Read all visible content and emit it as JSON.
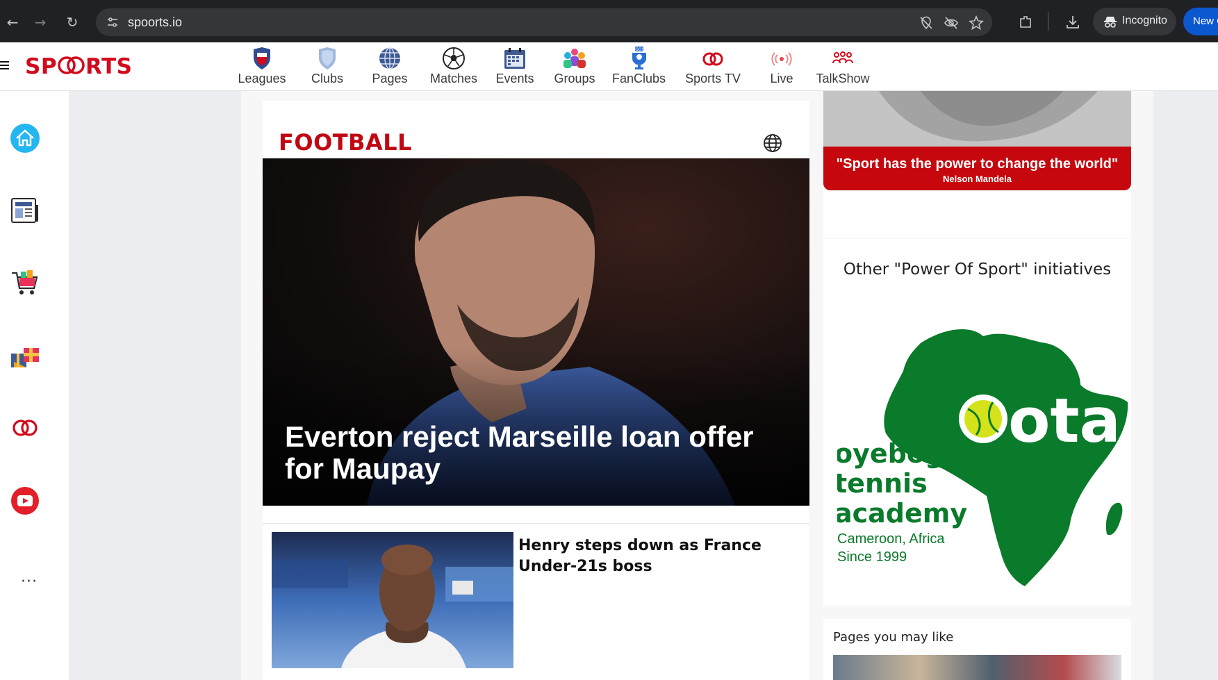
{
  "browser": {
    "url": "spoorts.io",
    "incognito_label": "Incognito",
    "new_button_label": "New C"
  },
  "site": {
    "logo": "SPOORTS",
    "nav": [
      {
        "label": "Leagues",
        "icon": "leagues-shield-icon"
      },
      {
        "label": "Clubs",
        "icon": "clubs-shield-icon"
      },
      {
        "label": "Pages",
        "icon": "globe-icon"
      },
      {
        "label": "Matches",
        "icon": "soccer-ball-icon"
      },
      {
        "label": "Events",
        "icon": "calendar-icon"
      },
      {
        "label": "Groups",
        "icon": "groups-icon"
      },
      {
        "label": "FanClubs",
        "icon": "fanclubs-icon"
      },
      {
        "label": "Sports TV",
        "icon": "sports-tv-icon"
      },
      {
        "label": "Live",
        "icon": "live-broadcast-icon"
      },
      {
        "label": "TalkShow",
        "icon": "talkshow-icon"
      }
    ],
    "sidebar": [
      "home-icon",
      "news-icon",
      "shop-cart-icon",
      "gift-icon",
      "spoorts-rings-icon",
      "youtube-icon",
      "more-icon"
    ]
  },
  "main": {
    "section_title": "FOOTBALL",
    "hero_title": "Everton reject Marseille loan offer for Maupay",
    "story_title": "Henry steps down as France Under-21s boss"
  },
  "right": {
    "quote": "\"Sport has the power to change the world\"",
    "quote_author": "Nelson Mandela",
    "initiatives_title": "Other \"Power Of Sport\" initiatives",
    "ota": {
      "letters": "ota",
      "name_line1": "oyebog",
      "name_line2": "tennis",
      "name_line3": "academy",
      "location": "Cameroon, Africa",
      "since": "Since 1999"
    },
    "pages_title": "Pages you may like"
  },
  "colors": {
    "brand_red": "#d3091c",
    "ota_green": "#0a7a2b",
    "tennis_yellow": "#d4e21b"
  }
}
